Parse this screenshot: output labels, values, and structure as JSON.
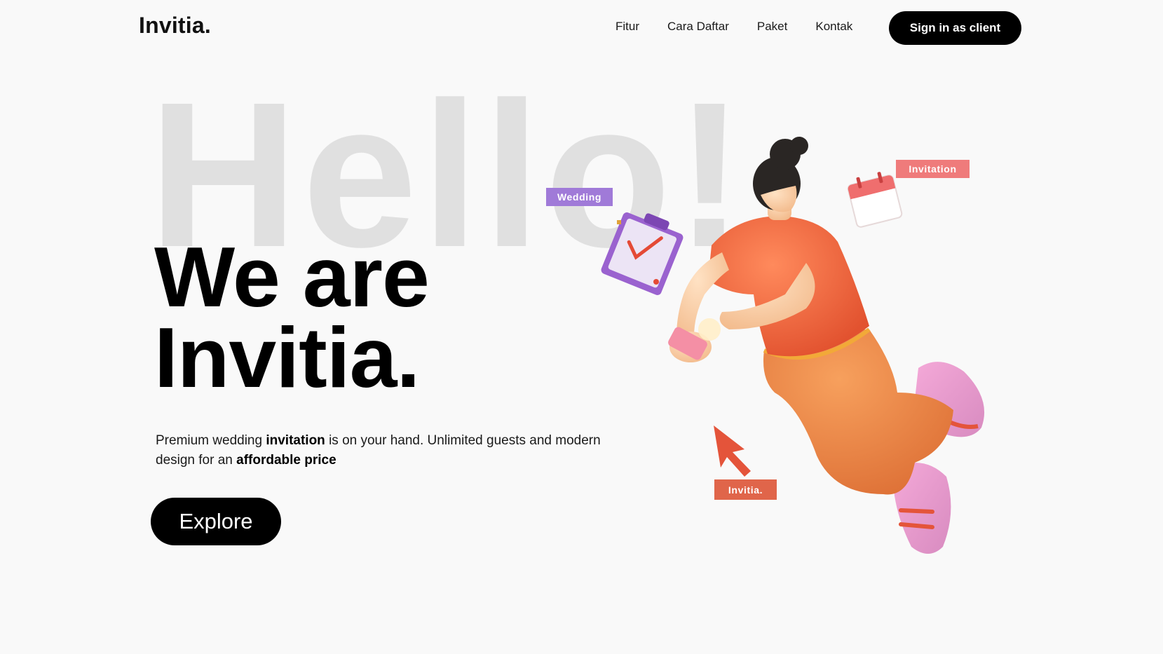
{
  "header": {
    "logo": "Invitia.",
    "nav": [
      "Fitur",
      "Cara Daftar",
      "Paket",
      "Kontak"
    ],
    "signin_label": "Sign in as client"
  },
  "hero": {
    "background_word": "Hello!",
    "title_line1": "We are",
    "title_line2": "Invitia.",
    "desc_part1": "Premium wedding ",
    "desc_bold1": "invitation",
    "desc_part2": " is on your hand. Unlimited guests and modern design for an ",
    "desc_bold2": "affordable price",
    "explore_label": "Explore"
  },
  "illustration": {
    "tags": {
      "wedding": "Wedding",
      "invitation": "Invitation",
      "invitia": "Invitia."
    },
    "icons": [
      "clipboard-icon",
      "calendar-icon",
      "cursor-arrow-icon",
      "person-with-phone-illustration"
    ]
  },
  "colors": {
    "accent_black": "#000000",
    "tag_purple": "#a07ad8",
    "tag_pink": "#ef7b7b",
    "tag_orange": "#e0654a",
    "shirt": "#f26a45",
    "pants": "#ec8a4a"
  }
}
